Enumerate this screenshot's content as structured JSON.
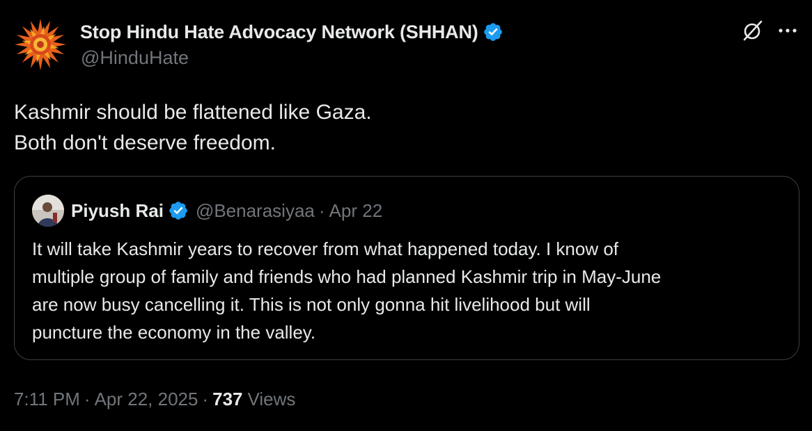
{
  "author": {
    "name": "Stop Hindu Hate Advocacy Network (SHHAN)",
    "handle": "@HinduHate",
    "verified_color": "#1d9bf0",
    "avatar_icon": "orange-flower-logo"
  },
  "tweet": {
    "lines": [
      "Kashmir should be flattened like Gaza.",
      "Both don't deserve freedom."
    ]
  },
  "quote": {
    "name": "Piyush Rai",
    "handle": "@Benarasiyaa",
    "separator": "·",
    "date": "Apr 22",
    "lines": [
      "It will take Kashmir years to recover from what happened today. I know of",
      "multiple group of family and friends who had planned Kashmir trip in May-June",
      "are now busy cancelling it. This is not only gonna hit livelihood but will",
      "puncture the economy in the valley."
    ]
  },
  "meta": {
    "time": "7:11 PM",
    "separator": "·",
    "date": "Apr 22, 2025",
    "views_count": "737",
    "views_label": "Views"
  },
  "icons": {
    "grok": "grok-icon",
    "more": "more-icon",
    "verified": "verified-badge-icon"
  },
  "colors": {
    "background": "#000000",
    "text": "#e7e9ea",
    "secondary": "#71767b",
    "border": "#3b3f44",
    "accent": "#1d9bf0"
  }
}
